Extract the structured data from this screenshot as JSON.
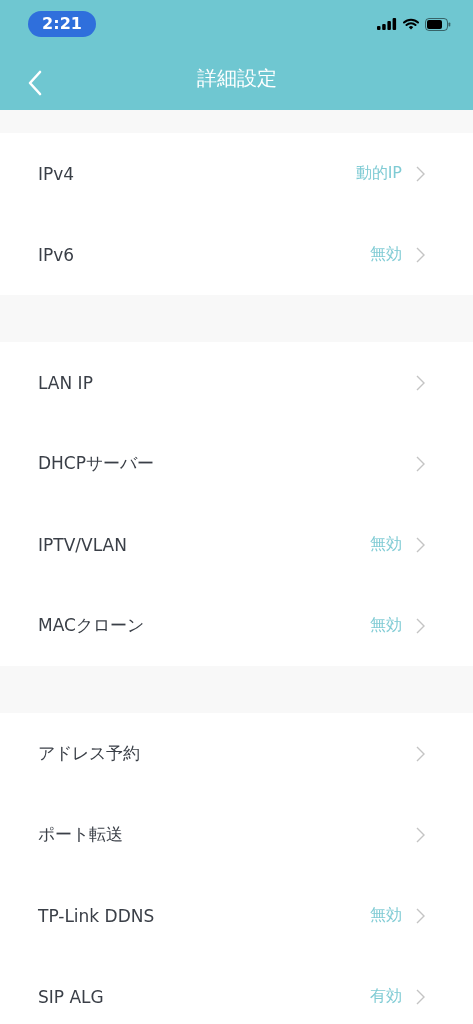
{
  "status_bar": {
    "time": "2:21"
  },
  "nav": {
    "title": "詳細設定"
  },
  "groups": [
    {
      "items": [
        {
          "label": "IPv4",
          "value": "動的IP"
        },
        {
          "label": "IPv6",
          "value": "無効"
        }
      ]
    },
    {
      "items": [
        {
          "label": "LAN IP"
        },
        {
          "label": "DHCPサーバー"
        },
        {
          "label": "IPTV/VLAN",
          "value": "無効"
        },
        {
          "label": "MACクローン",
          "value": "無効"
        }
      ]
    },
    {
      "items": [
        {
          "label": "アドレス予約"
        },
        {
          "label": "ポート転送"
        },
        {
          "label": "TP-Link DDNS",
          "value": "無効"
        },
        {
          "label": "SIP ALG",
          "value": "有効"
        }
      ]
    }
  ]
}
